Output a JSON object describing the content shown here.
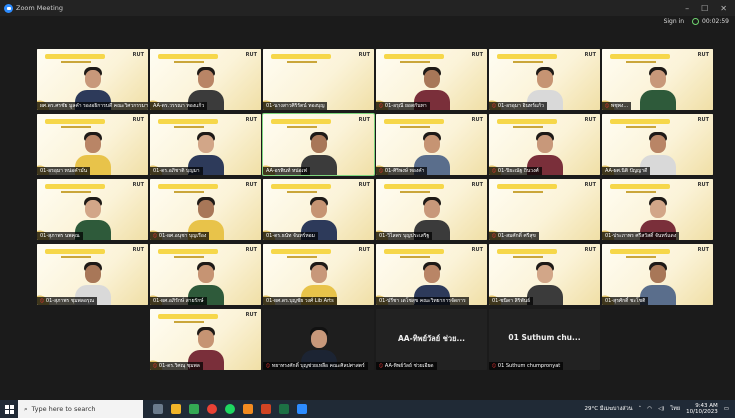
{
  "window": {
    "title": "Zoom Meeting",
    "controls": [
      "–",
      "☐",
      "✕"
    ]
  },
  "topbar": {
    "sign_in": "Sign in",
    "timer": "00:02:59"
  },
  "slide": {
    "brand": "RUT"
  },
  "participants": [
    {
      "name": "ผศ.ดร.ศรชัย มูลคำ รองอธิการบดี คณะวิศวกรรมฯ",
      "type": "video",
      "muted": false,
      "speaker": false
    },
    {
      "name": "AA-ดร.วรรณา ทองแก้ว",
      "type": "video",
      "muted": false,
      "speaker": false
    },
    {
      "name": "01-นางสาวศิริรัตน์ ทองบุญ",
      "type": "slide",
      "muted": false,
      "speaker": false
    },
    {
      "name": "01-อรุณี ยอดกันทา",
      "type": "video",
      "muted": true,
      "speaker": false
    },
    {
      "name": "01-อรอุมา อินทร์แก้ว",
      "type": "video",
      "muted": true,
      "speaker": false
    },
    {
      "name": "พชุพง...",
      "type": "video",
      "muted": true,
      "speaker": false
    },
    {
      "name": "01-อรอุมา หน่อคำมั่น",
      "type": "video",
      "muted": false,
      "speaker": false
    },
    {
      "name": "01-ดร.อภิชาติ บุญมา",
      "type": "video",
      "muted": false,
      "speaker": false
    },
    {
      "name": "AA-อรพินท์ หน่อเฟ",
      "type": "video",
      "muted": false,
      "speaker": true
    },
    {
      "name": "01-ศิริพงษ์ ทองคำ",
      "type": "video",
      "muted": true,
      "speaker": false
    },
    {
      "name": "01-ปิยะณัฐ ถิ่นวงศ์",
      "type": "video",
      "muted": true,
      "speaker": false
    },
    {
      "name": "AA-ผศ.นิติ ปัญญาดี",
      "type": "video",
      "muted": false,
      "speaker": false
    },
    {
      "name": "01-สุภาพร นพคุณ",
      "type": "video",
      "muted": false,
      "speaker": false
    },
    {
      "name": "01-ผศ.อนุชา บุญเรือง",
      "type": "video",
      "muted": true,
      "speaker": false
    },
    {
      "name": "01-ดร.ธนัท จันทร์หอม",
      "type": "video",
      "muted": false,
      "speaker": false
    },
    {
      "name": "01-วิไลพร บุญประเสริฐ",
      "type": "video",
      "muted": false,
      "speaker": false
    },
    {
      "name": "01-สมศักดิ์ ศรีสุข",
      "type": "slide",
      "muted": true,
      "speaker": false
    },
    {
      "name": "01-ประภาพร ศรีสวัสดิ์ จันทร์แดง",
      "type": "video",
      "muted": false,
      "speaker": false
    },
    {
      "name": "01-สุภาพร ชุมพลอรุณ",
      "type": "video",
      "muted": true,
      "speaker": false
    },
    {
      "name": "01-ผศ.อภิรักษ์ สายรักษ์",
      "type": "video",
      "muted": false,
      "speaker": false
    },
    {
      "name": "01-ผศ.ดร.บุญชัย วงศ์ Lib Arts",
      "type": "video",
      "muted": false,
      "speaker": false
    },
    {
      "name": "01-ปรีชา เดโชสุข คณะวิทยาการจัดการ",
      "type": "video",
      "muted": false,
      "speaker": false
    },
    {
      "name": "01-ชนิดา สิริพันธ์",
      "type": "video",
      "muted": false,
      "speaker": false
    },
    {
      "name": "01-สุรศักดิ์ ชะโชติ",
      "type": "video",
      "muted": false,
      "speaker": false
    },
    {
      "name": "01-ดร.วิศณุ ชุมพล",
      "type": "video",
      "muted": true,
      "speaker": false
    },
    {
      "name": "ทยาทรงศักดิ์ บุญช่วยเหลือ คณะศิลปศาสตร์",
      "type": "photo",
      "muted": true,
      "speaker": false
    },
    {
      "name": "AA-ทิพย์วัลย์ ช่วยเอียด",
      "type": "dark",
      "display": "AA-ทิพย์วัลย์ ช่วย...",
      "muted": true,
      "speaker": false
    },
    {
      "name": "01 Suthum chumpronyat",
      "type": "dark",
      "display": "01 Suthum chu...",
      "muted": true,
      "speaker": false
    }
  ],
  "taskbar": {
    "search_placeholder": "Type here to search",
    "weather": "29°C มีเมฆบางส่วน",
    "lang": "ไทย",
    "time": "9:43 AM",
    "date": "10/10/2023"
  },
  "colors": {
    "zoom_blue": "#2d8cff",
    "slide_yellow": "#f6d74a",
    "active_speaker": "#7cd37c",
    "muted_red": "#e33333"
  }
}
